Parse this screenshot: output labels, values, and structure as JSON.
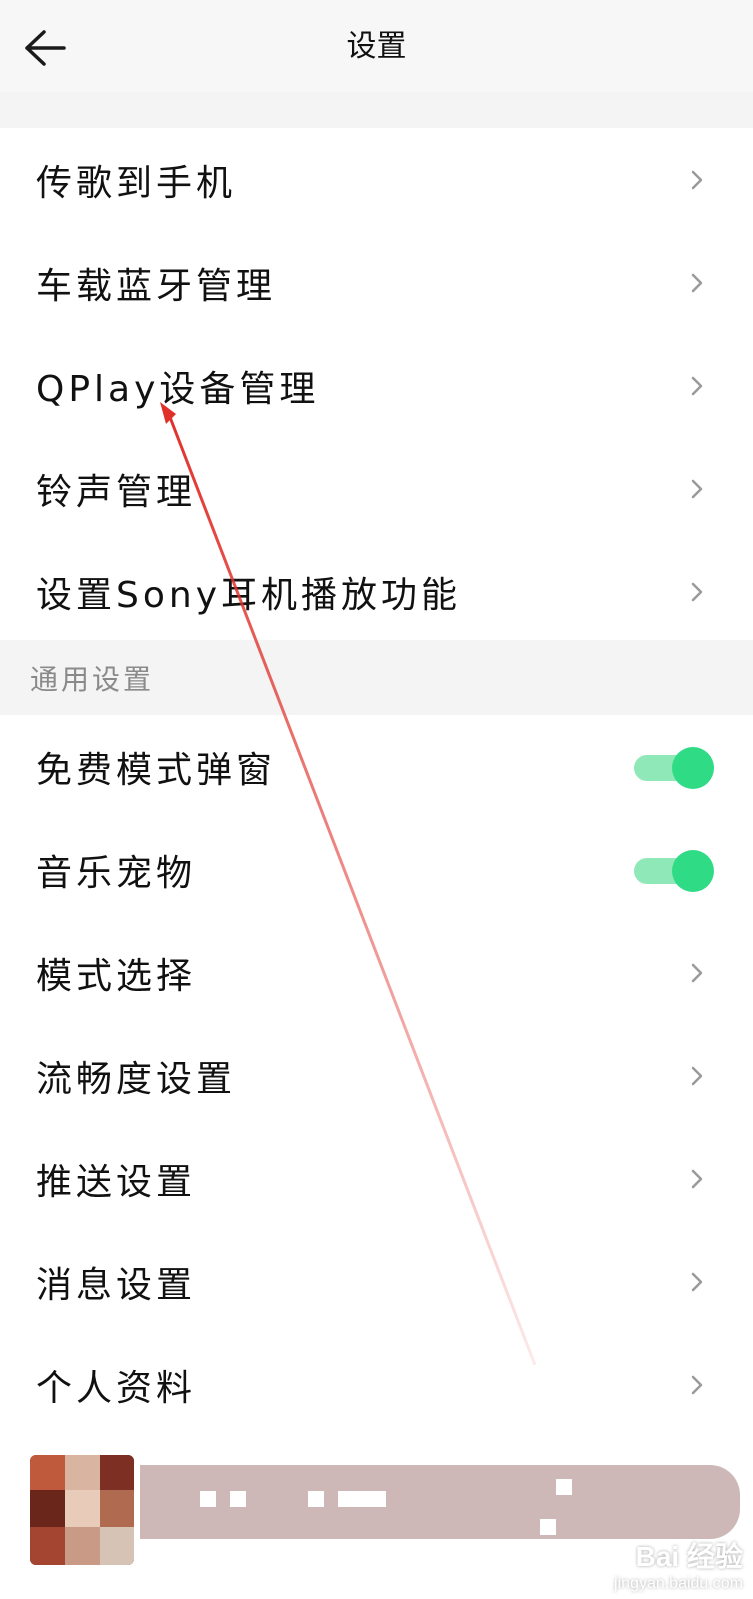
{
  "header": {
    "title": "设置"
  },
  "group1": {
    "items": [
      {
        "label": "传歌到手机"
      },
      {
        "label": "车载蓝牙管理"
      },
      {
        "label": "QPlay设备管理"
      },
      {
        "label": "铃声管理"
      },
      {
        "label": "设置Sony耳机播放功能"
      }
    ]
  },
  "general": {
    "section_label": "通用设置",
    "items": [
      {
        "label": "免费模式弹窗",
        "toggle_on": true
      },
      {
        "label": "音乐宠物",
        "toggle_on": true
      },
      {
        "label": "模式选择"
      },
      {
        "label": "流畅度设置"
      },
      {
        "label": "推送设置"
      },
      {
        "label": "消息设置"
      },
      {
        "label": "个人资料"
      }
    ]
  },
  "colors": {
    "toggle_on": "#2fdc85",
    "toggle_track": "#8fe8b7",
    "annotation_arrow": "#e0302a",
    "section_bg": "#f4f4f4"
  },
  "watermark": {
    "brand": "Bai 经验",
    "url": "jingyan.baidu.com"
  }
}
